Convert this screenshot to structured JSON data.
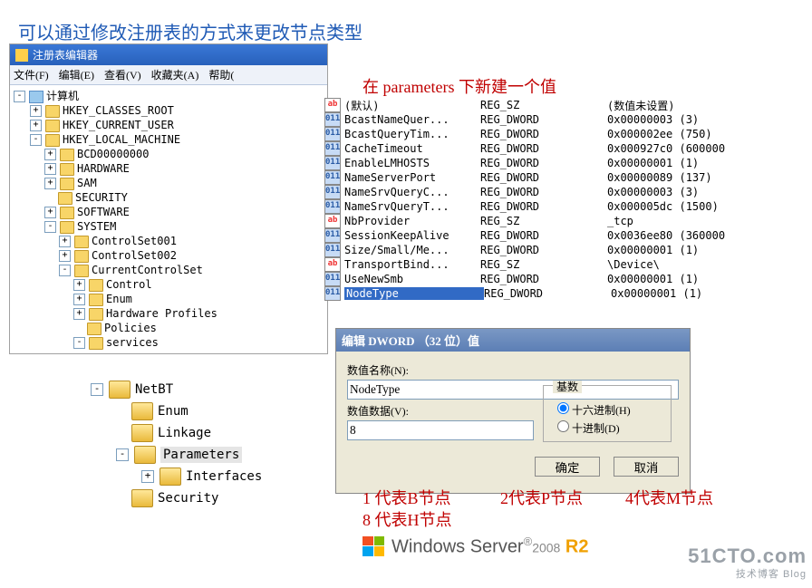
{
  "heading": "可以通过修改注册表的方式来更改节点类型",
  "regedit": {
    "title": "注册表编辑器",
    "menu": [
      "文件(F)",
      "编辑(E)",
      "查看(V)",
      "收藏夹(A)",
      "帮助("
    ],
    "tree": [
      {
        "lvl": 0,
        "exp": "-",
        "icon": "comp",
        "label": "计算机"
      },
      {
        "lvl": 1,
        "exp": "+",
        "icon": "fld",
        "label": "HKEY_CLASSES_ROOT"
      },
      {
        "lvl": 1,
        "exp": "+",
        "icon": "fld",
        "label": "HKEY_CURRENT_USER"
      },
      {
        "lvl": 1,
        "exp": "-",
        "icon": "fld",
        "label": "HKEY_LOCAL_MACHINE"
      },
      {
        "lvl": 2,
        "exp": "+",
        "icon": "fld",
        "label": "BCD00000000"
      },
      {
        "lvl": 2,
        "exp": "+",
        "icon": "fld",
        "label": "HARDWARE"
      },
      {
        "lvl": 2,
        "exp": "+",
        "icon": "fld",
        "label": "SAM"
      },
      {
        "lvl": 2,
        "exp": "",
        "icon": "fld",
        "label": "SECURITY"
      },
      {
        "lvl": 2,
        "exp": "+",
        "icon": "fld",
        "label": "SOFTWARE"
      },
      {
        "lvl": 2,
        "exp": "-",
        "icon": "fld",
        "label": "SYSTEM"
      },
      {
        "lvl": 3,
        "exp": "+",
        "icon": "fld",
        "label": "ControlSet001"
      },
      {
        "lvl": 3,
        "exp": "+",
        "icon": "fld",
        "label": "ControlSet002"
      },
      {
        "lvl": 3,
        "exp": "-",
        "icon": "fld",
        "label": "CurrentControlSet"
      },
      {
        "lvl": 4,
        "exp": "+",
        "icon": "fld",
        "label": "Control"
      },
      {
        "lvl": 4,
        "exp": "+",
        "icon": "fld",
        "label": "Enum"
      },
      {
        "lvl": 4,
        "exp": "+",
        "icon": "fld",
        "label": "Hardware Profiles"
      },
      {
        "lvl": 4,
        "exp": "",
        "icon": "fld",
        "label": "Policies"
      },
      {
        "lvl": 4,
        "exp": "-",
        "icon": "fld",
        "label": "services"
      }
    ]
  },
  "tree2": [
    {
      "cls": "t2a",
      "exp": "-",
      "label": "NetBT",
      "sel": false
    },
    {
      "cls": "t2b",
      "exp": "",
      "label": "Enum",
      "sel": false
    },
    {
      "cls": "t2b",
      "exp": "",
      "label": "Linkage",
      "sel": false
    },
    {
      "cls": "t2b",
      "exp": "-",
      "label": "Parameters",
      "sel": true
    },
    {
      "cls": "t2c",
      "exp": "+",
      "label": "Interfaces",
      "sel": false
    },
    {
      "cls": "t2b",
      "exp": "",
      "label": "Security",
      "sel": false
    }
  ],
  "cap_params": "在 parameters 下新建一个值",
  "values": [
    {
      "icon": "ab",
      "name": "(默认)",
      "type": "REG_SZ",
      "data": "(数值未设置)"
    },
    {
      "icon": "bn",
      "name": "BcastNameQuer...",
      "type": "REG_DWORD",
      "data": "0x00000003 (3)"
    },
    {
      "icon": "bn",
      "name": "BcastQueryTim...",
      "type": "REG_DWORD",
      "data": "0x000002ee (750)"
    },
    {
      "icon": "bn",
      "name": "CacheTimeout",
      "type": "REG_DWORD",
      "data": "0x000927c0 (600000"
    },
    {
      "icon": "bn",
      "name": "EnableLMHOSTS",
      "type": "REG_DWORD",
      "data": "0x00000001 (1)"
    },
    {
      "icon": "bn",
      "name": "NameServerPort",
      "type": "REG_DWORD",
      "data": "0x00000089 (137)"
    },
    {
      "icon": "bn",
      "name": "NameSrvQueryC...",
      "type": "REG_DWORD",
      "data": "0x00000003 (3)"
    },
    {
      "icon": "bn",
      "name": "NameSrvQueryT...",
      "type": "REG_DWORD",
      "data": "0x000005dc (1500)"
    },
    {
      "icon": "ab",
      "name": "NbProvider",
      "type": "REG_SZ",
      "data": "_tcp"
    },
    {
      "icon": "bn",
      "name": "SessionKeepAlive",
      "type": "REG_DWORD",
      "data": "0x0036ee80 (360000"
    },
    {
      "icon": "bn",
      "name": "Size/Small/Me...",
      "type": "REG_DWORD",
      "data": "0x00000001 (1)"
    },
    {
      "icon": "ab",
      "name": "TransportBind...",
      "type": "REG_SZ",
      "data": "\\Device\\"
    },
    {
      "icon": "bn",
      "name": "UseNewSmb",
      "type": "REG_DWORD",
      "data": "0x00000001 (1)"
    },
    {
      "icon": "bn",
      "name": "NodeType",
      "type": "REG_DWORD",
      "data": "0x00000001 (1)",
      "sel": true
    }
  ],
  "dlg": {
    "title": "编辑 DWORD （32 位）值",
    "lbl_name": "数值名称(N):",
    "val_name": "NodeType",
    "lbl_data": "数值数据(V):",
    "val_data": "8",
    "grp": "基数",
    "hex": "十六进制(H)",
    "dec": "十进制(D)",
    "ok": "确定",
    "cancel": "取消"
  },
  "legend1": "1 代表B节点",
  "legend2": "2代表P节点",
  "legend4": "4代表M节点",
  "legend8": "8 代表H节点",
  "footer": {
    "brand": "Windows Server",
    "ver": "2008",
    "r2": "R2"
  },
  "watermark": {
    "big": "51CTO.com",
    "small": "技术博客   Blog"
  }
}
